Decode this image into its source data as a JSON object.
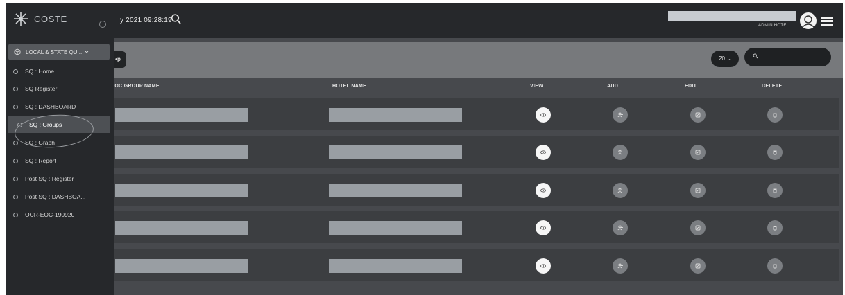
{
  "sidebar": {
    "brand": "COSTE",
    "module_label": "LOCAL & STATE QU...",
    "items": [
      {
        "label": "SQ : Home"
      },
      {
        "label": "SQ Register"
      },
      {
        "label": "SQ : DASHBOARD"
      },
      {
        "label": "SQ : Groups"
      },
      {
        "label": "SQ : Graph"
      },
      {
        "label": "SQ : Report"
      },
      {
        "label": "Post SQ : Register"
      },
      {
        "label": "Post SQ : DASHBOA..."
      },
      {
        "label": "OCR-EOC-190920"
      }
    ]
  },
  "topbar": {
    "datetime": "y 2021 09:28:19",
    "role": "ADMIN HOTEL"
  },
  "toolbar": {
    "group_button": "•p",
    "page_size": "20 ⌄"
  },
  "table": {
    "headers": [
      "DOC GROUP NAME",
      "HOTEL NAME",
      "VIEW",
      "ADD",
      "EDIT",
      "DELETE"
    ],
    "row_count": 5
  },
  "colors": {
    "sidebar_bg": "#26282b",
    "content_bg": "#47494d",
    "header_band": "#77797c",
    "row_bg": "#3c3e41",
    "redacted_bar": "#999ea3"
  }
}
